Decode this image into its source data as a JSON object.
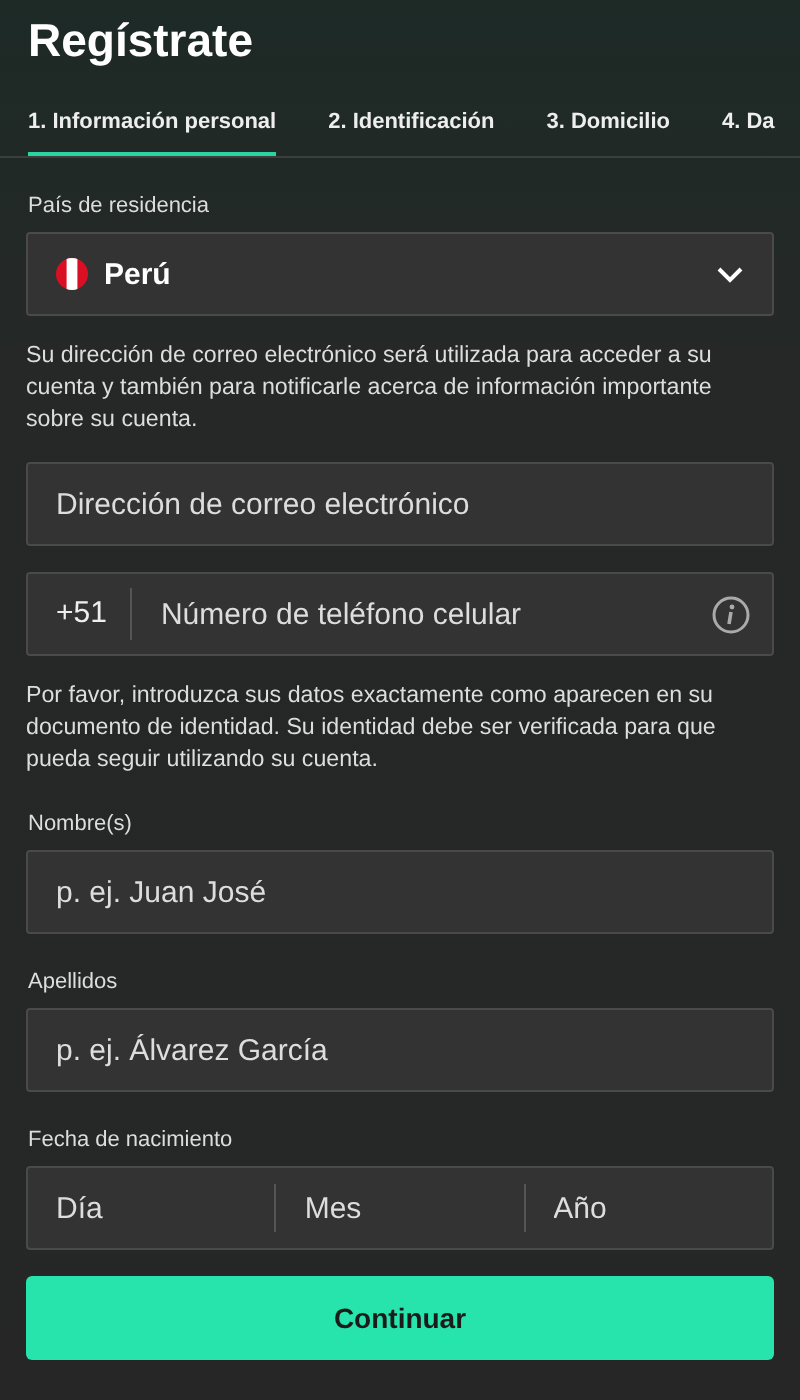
{
  "title": "Regístrate",
  "tabs": [
    {
      "label": "1. Información personal",
      "selected": true
    },
    {
      "label": "2. Identificación",
      "selected": false
    },
    {
      "label": "3. Domicilio",
      "selected": false
    },
    {
      "label": "4. Da",
      "selected": false
    }
  ],
  "country": {
    "label": "País de residencia",
    "value": "Perú"
  },
  "email_note": "Su dirección de correo electrónico será utilizada para acceder a su cuenta y también para notificarle acerca de información importante sobre su cuenta.",
  "email": {
    "placeholder": "Dirección de correo electrónico"
  },
  "phone": {
    "prefix": "+51",
    "placeholder": "Número de teléfono celular"
  },
  "identity_note": "Por favor, introduzca sus datos exactamente como aparecen en su documento de identidad. Su identidad debe ser verificada para que pueda seguir utilizando su cuenta.",
  "first_name": {
    "label": "Nombre(s)",
    "placeholder": "p. ej. Juan José"
  },
  "last_name": {
    "label": "Apellidos",
    "placeholder": "p. ej. Álvarez García"
  },
  "birth_date": {
    "label": "Fecha de nacimiento",
    "parts": [
      {
        "placeholder": "Día"
      },
      {
        "placeholder": "Mes"
      },
      {
        "placeholder": "Año"
      }
    ]
  },
  "button": "Continuar"
}
